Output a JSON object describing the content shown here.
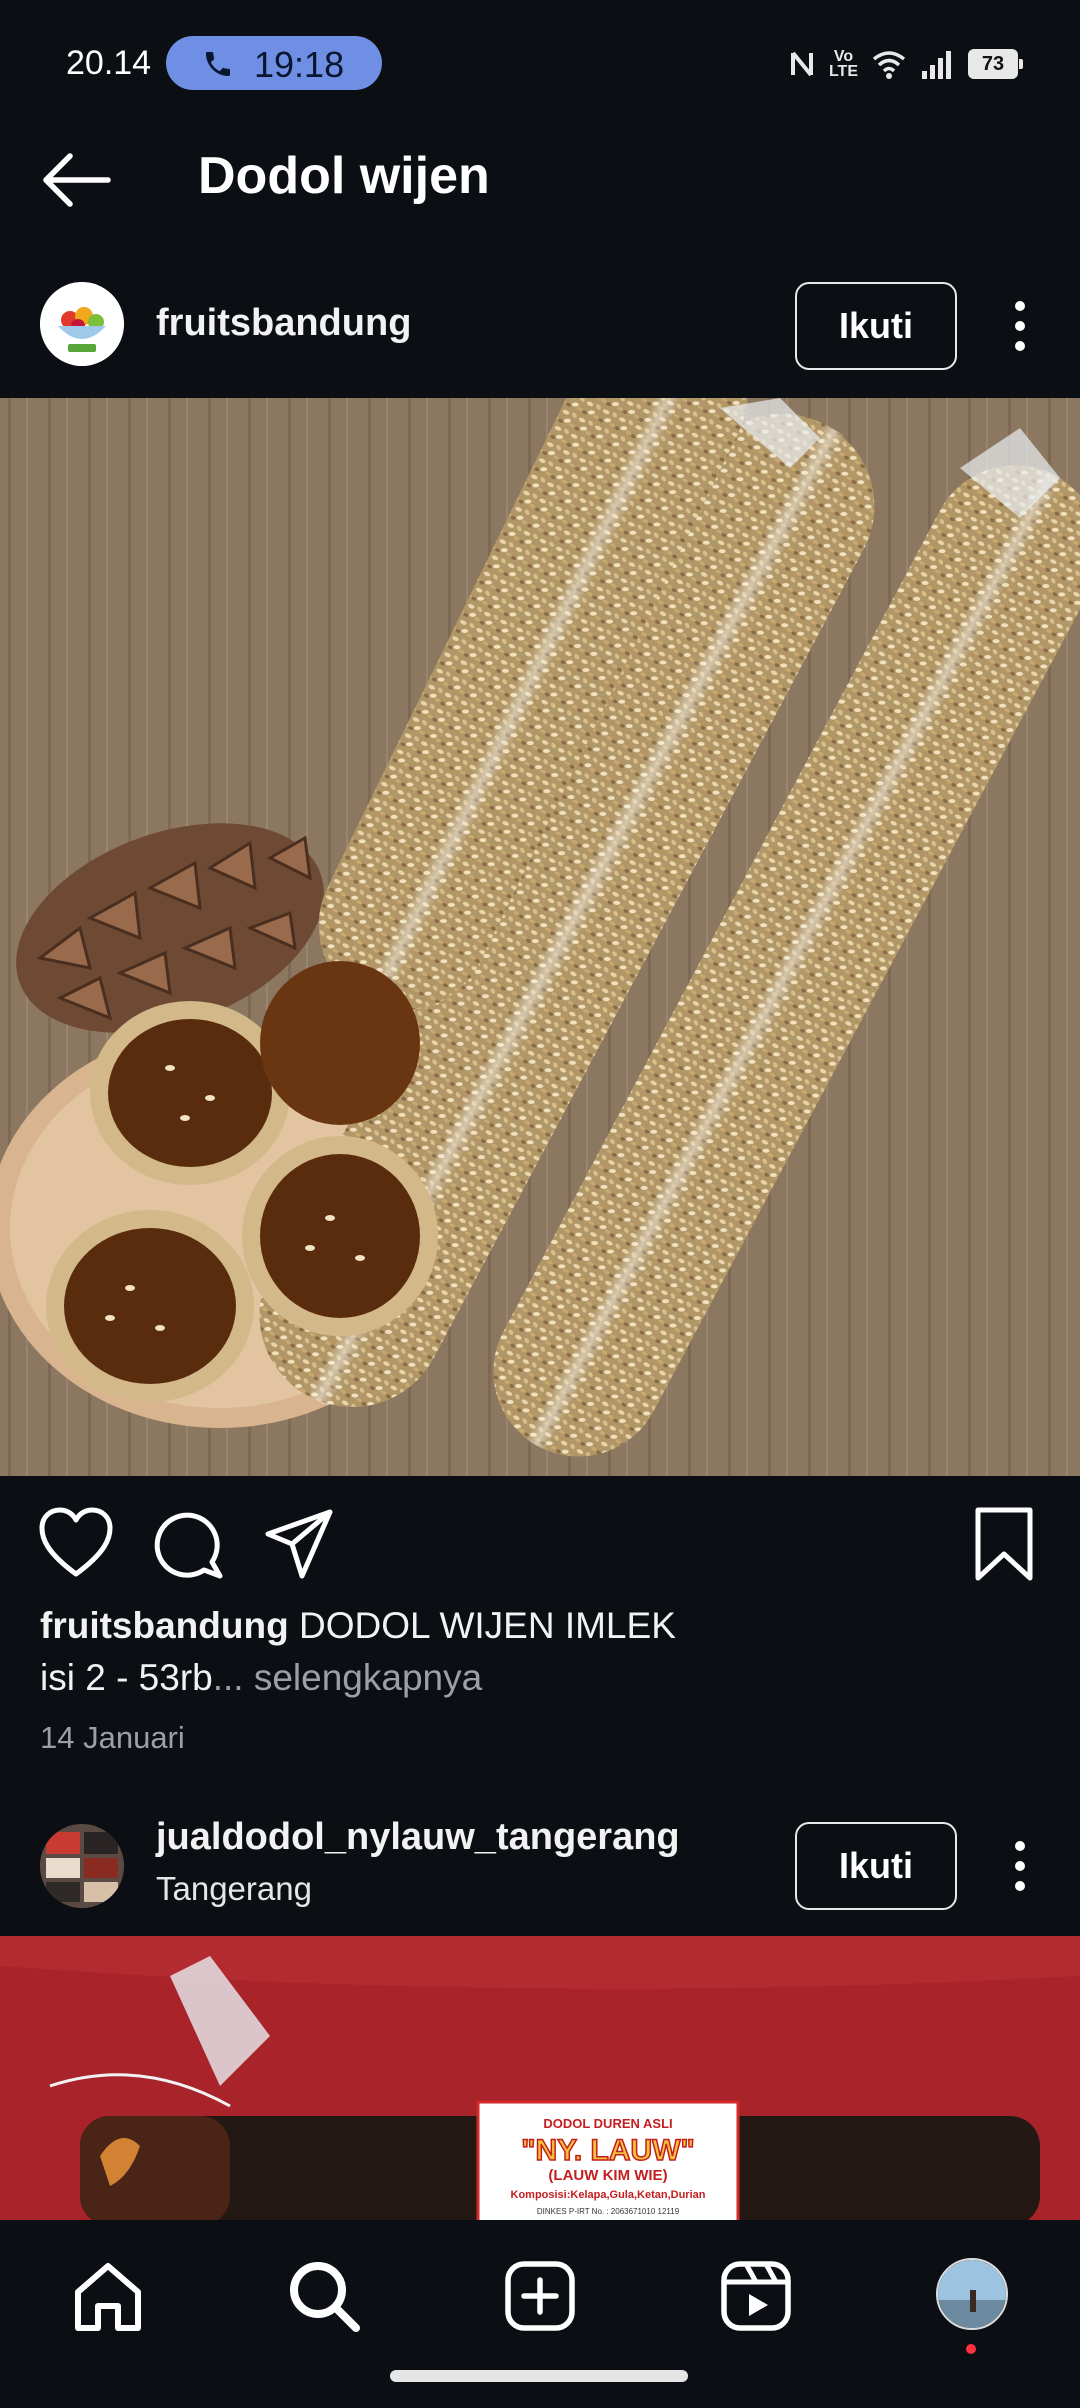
{
  "status_bar": {
    "time": "20.14",
    "call_timer": "19:18",
    "battery": "73",
    "network_label": "Vo LTE"
  },
  "header": {
    "title": "Dodol wijen"
  },
  "posts": [
    {
      "username": "fruitsbandung",
      "follow_label": "Ikuti",
      "caption_text": "DODOL WIJEN IMLEK",
      "caption_line2": "isi  2 - 53rb",
      "more_label": "... selengkapnya",
      "date": "14 Januari"
    },
    {
      "username": "jualdodol_nylauw_tangerang",
      "location": "Tangerang",
      "follow_label": "Ikuti",
      "label_top": "DODOL DUREN ASLI",
      "label_brand": "\"NY. LAUW\"",
      "label_name": "(LAUW KIM WIE)",
      "label_composition": "Komposisi:Kelapa,Gula,Ketan,Durian",
      "label_permit": "DINKES P-IRT No. : 2063671010 12119"
    }
  ],
  "icons": {
    "back": "arrow-left-icon",
    "more": "more-vertical-icon",
    "like": "heart-icon",
    "comment": "comment-icon",
    "share": "send-icon",
    "save": "bookmark-icon",
    "nav_home": "home-icon",
    "nav_search": "search-icon",
    "nav_create": "plus-square-icon",
    "nav_reels": "reels-icon"
  },
  "colors": {
    "background": "#0b0f14",
    "call_pill": "#6f8fe4",
    "notification_dot": "#ff3040",
    "secondary_text": "#9aa0a6"
  }
}
